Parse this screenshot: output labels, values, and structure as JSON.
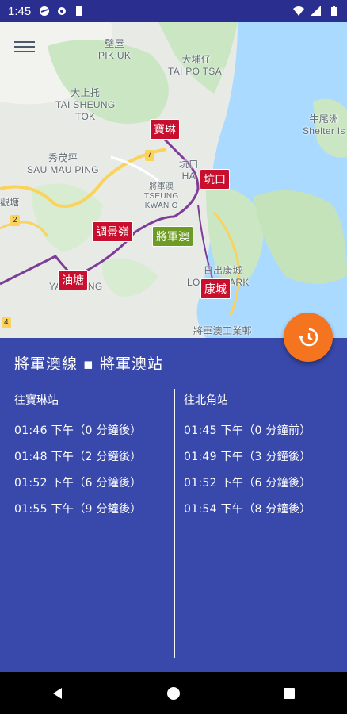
{
  "status_bar": {
    "time": "1:45",
    "left_icons": [
      "messaging-icon",
      "settings-gear-icon",
      "sd-card-icon"
    ],
    "right_icons": [
      "wifi-icon",
      "signal-icon",
      "battery-icon"
    ]
  },
  "map": {
    "places": {
      "pik_uk_zh": "壁屋",
      "pik_uk_en": "PIK UK",
      "tai_po_tsai_zh": "大埔仔",
      "tai_po_tsai_en": "TAI PO TSAI",
      "tai_sheung_tok_zh": "大上托",
      "tai_sheung_tok_en": "TAI SHEUNG",
      "tai_sheung_tok_en2": "TOK",
      "sau_mau_ping_zh": "秀茂坪",
      "sau_mau_ping_en": "SAU MAU PING",
      "tko_zh": "將軍澳",
      "tko_en": "TSEUNG",
      "tko_en2": "KWAN O",
      "hang_hau_zh": "坑口",
      "hang_hau_en": "HA",
      "lohas_zh": "日出康城",
      "lohas_en": "LO",
      "lohas_en2": "PARK",
      "shelter_zh": "牛尾洲",
      "shelter_en": "Shelter Is",
      "kwun_tong": "觀塘",
      "yau_tong": "YAU",
      "yau_tong2": "ONG",
      "tko_industrial": "將軍澳工業邨",
      "route_7": "7",
      "route_2": "2",
      "route_4": "4"
    },
    "stations": {
      "po_lam": "寶琳",
      "hang_hau": "坑口",
      "tiu_keng_leng": "調景嶺",
      "tseung_kwan_o": "將軍澳",
      "yau_tong": "油塘",
      "lohas_park": "康城"
    }
  },
  "panel": {
    "title": "將軍澳線 ▪ 將軍澳站",
    "left_direction": "往寶琳站",
    "left_times": [
      "01:46 下午（0 分鐘後）",
      "01:48 下午（2 分鐘後）",
      "01:52 下午（6 分鐘後）",
      "01:55 下午（9 分鐘後）"
    ],
    "right_direction": "往北角站",
    "right_times": [
      "01:45 下午（0 分鐘前）",
      "01:49 下午（3 分鐘後）",
      "01:52 下午（6 分鐘後）",
      "01:54 下午（8 分鐘後）"
    ]
  },
  "colors": {
    "status_bar": "#2a2f8f",
    "panel": "#3949ab",
    "fab": "#f5741f",
    "station_red": "#c8102e",
    "station_green": "#6e9b23",
    "line": "#7d3c98"
  },
  "fab_icon": "history-icon",
  "nav_icons": [
    "back-icon",
    "home-icon",
    "recents-icon"
  ]
}
